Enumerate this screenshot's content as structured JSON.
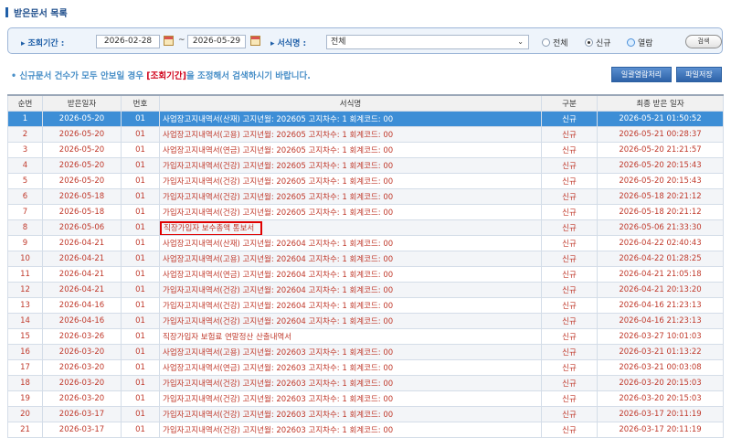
{
  "page_title": "받은문서 목록",
  "search": {
    "period_label": "조회기간 :",
    "date_from": "2026-02-28",
    "date_sep": "~",
    "date_to": "2026-05-29",
    "form_label": "서식명 :",
    "form_selected": "전체",
    "radios": [
      "전체",
      "신규",
      "열람"
    ],
    "selected_radio": "신규",
    "search_button": "검색"
  },
  "notice": {
    "prefix": "• 신규문서 건수가 모두 안보일 경우 ",
    "highlight": "[조회기간]",
    "suffix": "을 조정해서 검색하시기 바랍니다."
  },
  "buttons": {
    "bulk_read": "일괄열람처리",
    "save_file": "파일저장"
  },
  "table": {
    "headers": [
      "순번",
      "받은일자",
      "번호",
      "서식명",
      "구분",
      "최종 받은 일자"
    ],
    "rows": [
      [
        "1",
        "2026-05-20",
        "01",
        "사업장고지내역서(산재) 고지년월: 202605 고지차수: 1 회계코드: 00",
        "신규",
        "2026-05-21 01:50:52"
      ],
      [
        "2",
        "2026-05-20",
        "01",
        "사업장고지내역서(고용) 고지년월: 202605 고지차수: 1 회계코드: 00",
        "신규",
        "2026-05-21 00:28:37"
      ],
      [
        "3",
        "2026-05-20",
        "01",
        "사업장고지내역서(연금) 고지년월: 202605 고지차수: 1 회계코드: 00",
        "신규",
        "2026-05-20 21:21:57"
      ],
      [
        "4",
        "2026-05-20",
        "01",
        "가입자고지내역서(건강) 고지년월: 202605 고지차수: 1 회계코드: 00",
        "신규",
        "2026-05-20 20:15:43"
      ],
      [
        "5",
        "2026-05-20",
        "01",
        "가입자고지내역서(건강) 고지년월: 202605 고지차수: 1 회계코드: 00",
        "신규",
        "2026-05-20 20:15:43"
      ],
      [
        "6",
        "2026-05-18",
        "01",
        "가입자고지내역서(건강) 고지년월: 202605 고지차수: 1 회계코드: 00",
        "신규",
        "2026-05-18 20:21:12"
      ],
      [
        "7",
        "2026-05-18",
        "01",
        "가입자고지내역서(건강) 고지년월: 202605 고지차수: 1 회계코드: 00",
        "신규",
        "2026-05-18 20:21:12"
      ],
      [
        "8",
        "2026-05-06",
        "01",
        "직장가입자 보수총액 통보서",
        "신규",
        "2026-05-06 21:33:30"
      ],
      [
        "9",
        "2026-04-21",
        "01",
        "사업장고지내역서(산재) 고지년월: 202604 고지차수: 1 회계코드: 00",
        "신규",
        "2026-04-22 02:40:43"
      ],
      [
        "10",
        "2026-04-21",
        "01",
        "사업장고지내역서(고용) 고지년월: 202604 고지차수: 1 회계코드: 00",
        "신규",
        "2026-04-22 01:28:25"
      ],
      [
        "11",
        "2026-04-21",
        "01",
        "사업장고지내역서(연금) 고지년월: 202604 고지차수: 1 회계코드: 00",
        "신규",
        "2026-04-21 21:05:18"
      ],
      [
        "12",
        "2026-04-21",
        "01",
        "가입자고지내역서(건강) 고지년월: 202604 고지차수: 1 회계코드: 00",
        "신규",
        "2026-04-21 20:13:20"
      ],
      [
        "13",
        "2026-04-16",
        "01",
        "가입자고지내역서(건강) 고지년월: 202604 고지차수: 1 회계코드: 00",
        "신규",
        "2026-04-16 21:23:13"
      ],
      [
        "14",
        "2026-04-16",
        "01",
        "가입자고지내역서(건강) 고지년월: 202604 고지차수: 1 회계코드: 00",
        "신규",
        "2026-04-16 21:23:13"
      ],
      [
        "15",
        "2026-03-26",
        "01",
        "직장가입자 보험료 연말정산 산출내역서",
        "신규",
        "2026-03-27 10:01:03"
      ],
      [
        "16",
        "2026-03-20",
        "01",
        "사업장고지내역서(고용) 고지년월: 202603 고지차수: 1 회계코드: 00",
        "신규",
        "2026-03-21 01:13:22"
      ],
      [
        "17",
        "2026-03-20",
        "01",
        "사업장고지내역서(연금) 고지년월: 202603 고지차수: 1 회계코드: 00",
        "신규",
        "2026-03-21 00:03:08"
      ],
      [
        "18",
        "2026-03-20",
        "01",
        "가입자고지내역서(건강) 고지년월: 202603 고지차수: 1 회계코드: 00",
        "신규",
        "2026-03-20 20:15:03"
      ],
      [
        "19",
        "2026-03-20",
        "01",
        "가입자고지내역서(건강) 고지년월: 202603 고지차수: 1 회계코드: 00",
        "신규",
        "2026-03-20 20:15:03"
      ],
      [
        "20",
        "2026-03-17",
        "01",
        "가입자고지내역서(건강) 고지년월: 202603 고지차수: 1 회계코드: 00",
        "신규",
        "2026-03-17 20:11:19"
      ],
      [
        "21",
        "2026-03-17",
        "01",
        "가입자고지내역서(건강) 고지년월: 202603 고지차수: 1 회계코드: 00",
        "신규",
        "2026-03-17 20:11:19"
      ]
    ],
    "selected_row": "1",
    "boxed_row": "8"
  },
  "colors": {
    "accent": "#1f5fa8",
    "row_text": "#c0392b",
    "selected_row": "#3d8ed6",
    "highlight_box": "#e00000"
  }
}
